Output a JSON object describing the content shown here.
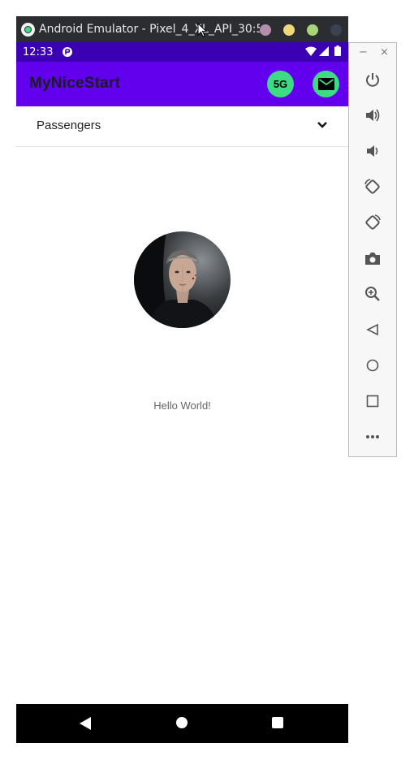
{
  "window": {
    "title": "Android Emulator - Pixel_4_XL_API_30:5...",
    "controls": [
      {
        "name": "minimize-dot",
        "color": "#b48ead"
      },
      {
        "name": "maximize-dot",
        "color": "#f0d77a"
      },
      {
        "name": "fullscreen-dot",
        "color": "#a8d37a"
      },
      {
        "name": "close-dot",
        "color": "#3b4252"
      }
    ]
  },
  "statusbar": {
    "time": "12:33"
  },
  "app": {
    "title": "MyNiceStart",
    "fiveg_label": "5G",
    "accent": "#6200ee",
    "status_color": "#3b00b3",
    "fab_color": "#3ddc84"
  },
  "dropdown": {
    "selected": "Passengers"
  },
  "main": {
    "hello_text": "Hello World!"
  },
  "side_panel": {
    "minimize": "−",
    "close": "×",
    "tools": [
      "power-icon",
      "volume-up-icon",
      "volume-down-icon",
      "rotate-left-icon",
      "rotate-right-icon",
      "camera-icon",
      "zoom-icon",
      "back-icon",
      "home-icon",
      "overview-icon",
      "more-icon"
    ]
  }
}
